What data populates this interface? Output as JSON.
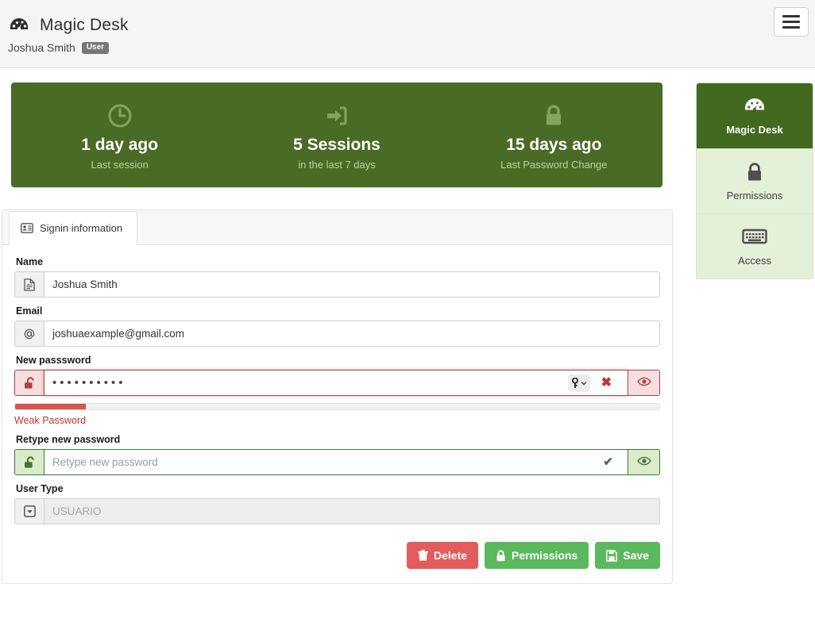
{
  "header": {
    "brand_title": "Magic Desk",
    "brand_logo_icon": "tachometer-icon",
    "user_name": "Joshua Smith",
    "user_badge": "User",
    "menu_icon": "hamburger-menu-icon"
  },
  "stats": [
    {
      "icon": "clock-icon",
      "value": "1 day ago",
      "label": "Last session"
    },
    {
      "icon": "sign-in-icon",
      "value": "5 Sessions",
      "label": "in the last 7 days"
    },
    {
      "icon": "lock-icon",
      "value": "15 days ago",
      "label": "Last Password Change"
    }
  ],
  "sidemenu": [
    {
      "icon": "tachometer-icon",
      "label": "Magic Desk",
      "active": true
    },
    {
      "icon": "lock-icon",
      "label": "Permissions",
      "active": false
    },
    {
      "icon": "keyboard-icon",
      "label": "Access",
      "active": false
    }
  ],
  "panel": {
    "tab": {
      "icon": "id-card-icon",
      "label": "Signin information"
    },
    "fields": {
      "name": {
        "label": "Name",
        "addon_icon": "file-text-icon",
        "value": "Joshua Smith",
        "placeholder": "Name"
      },
      "email": {
        "label": "Email",
        "addon_icon": "at-icon",
        "value": "joshuaexample@gmail.com",
        "placeholder": "Email"
      },
      "new_password": {
        "label": "New passsword",
        "addon_icon": "unlock-icon",
        "value": "••••••••••",
        "placeholder": "New passsword",
        "key_manager_icon": "key-icon",
        "clear_icon": "times-icon",
        "reveal_icon": "eye-icon",
        "state": "error"
      },
      "retype_password": {
        "label": "Retype new password",
        "addon_icon": "unlock-icon",
        "value": "",
        "placeholder": "Retype new password",
        "valid_icon": "check-icon",
        "reveal_icon": "eye-icon",
        "state": "success"
      },
      "user_type": {
        "label": "User Type",
        "addon_icon": "caret-square-down-icon",
        "value": "",
        "placeholder": "USUARIO",
        "state": "disabled"
      }
    },
    "password_strength": {
      "percent": 11,
      "text": "Weak Password",
      "color": "#d9534f"
    },
    "buttons": [
      {
        "icon": "trash-icon",
        "label": "Delete",
        "style": "danger"
      },
      {
        "icon": "lock-icon",
        "label": "Permissions",
        "style": "success"
      },
      {
        "icon": "floppy-disk-icon",
        "label": "Save",
        "style": "success"
      }
    ]
  },
  "colors": {
    "banner_green": "#4a6b26",
    "sidemenu_active": "#41691f",
    "sidemenu_bg": "#e5f0d9",
    "danger": "#d9534f",
    "success": "#5cb85c"
  }
}
